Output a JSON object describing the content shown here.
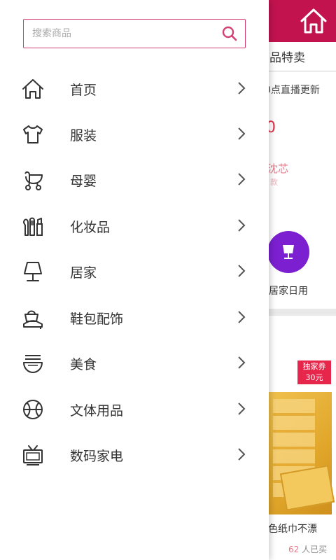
{
  "drawer": {
    "search": {
      "placeholder": "搜索商品"
    },
    "items": [
      {
        "label": "首页",
        "icon": "home-icon"
      },
      {
        "label": "服装",
        "icon": "tshirt-icon"
      },
      {
        "label": "母婴",
        "icon": "stroller-icon"
      },
      {
        "label": "化妆品",
        "icon": "cosmetics-icon"
      },
      {
        "label": "居家",
        "icon": "lamp-icon"
      },
      {
        "label": "鞋包配饰",
        "icon": "shoe-bag-icon"
      },
      {
        "label": "美食",
        "icon": "noodle-bowl-icon"
      },
      {
        "label": "文体用品",
        "icon": "ball-icon"
      },
      {
        "label": "数码家电",
        "icon": "tv-icon"
      }
    ]
  },
  "background": {
    "tab_text": "品特卖",
    "broadcast_text": "0点直播更新",
    "red_char": "0",
    "pink_text": "沈芯",
    "pink_small": "款",
    "category_label": "居家日用",
    "coupon": {
      "line1": "独家券",
      "line2": "30元"
    },
    "product_title": "色纸巾不漂",
    "sold_count": "62",
    "sold_suffix": "人已买"
  },
  "colors": {
    "header": "#c2134f",
    "accent": "#d43f73",
    "lamp_circle": "#7b1fd0",
    "coupon": "#e6264a"
  }
}
